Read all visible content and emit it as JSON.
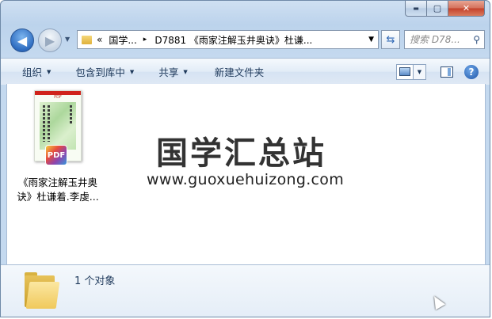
{
  "window": {
    "caption_buttons": {
      "minimize": "▬",
      "maximize": "▢",
      "close": "✕"
    }
  },
  "nav": {
    "back_glyph": "◀",
    "forward_glyph": "▶"
  },
  "address": {
    "overflow": "«",
    "segments": [
      "国学...",
      "D7881 《雨家注解玉井奥诀》杜谦..."
    ],
    "separator": "▸",
    "dropdown": "▼"
  },
  "search": {
    "placeholder": "搜索 D78...",
    "icon": "⚲"
  },
  "refresh_glyph": "⇆",
  "toolbar": {
    "organize": "组织",
    "include_in_library": "包含到库中",
    "share": "共享",
    "new_folder": "新建文件夹",
    "dropdown_glyph": "▼",
    "help": "?"
  },
  "files": [
    {
      "name_line1": "《雨家注解玉井奥",
      "name_line2": "诀》杜谦着.李虔...",
      "thumb_header": "PDF",
      "badge": "PDF"
    }
  ],
  "watermark": {
    "logo": "国学汇总站",
    "url": "www.guoxuehuizong.com"
  },
  "details": {
    "count": "1 个对象"
  },
  "colors": {
    "frame": "#bcd3ec",
    "toolbar": "#dfe9f5",
    "accent": "#2e6cc0",
    "close": "#c4412a"
  }
}
